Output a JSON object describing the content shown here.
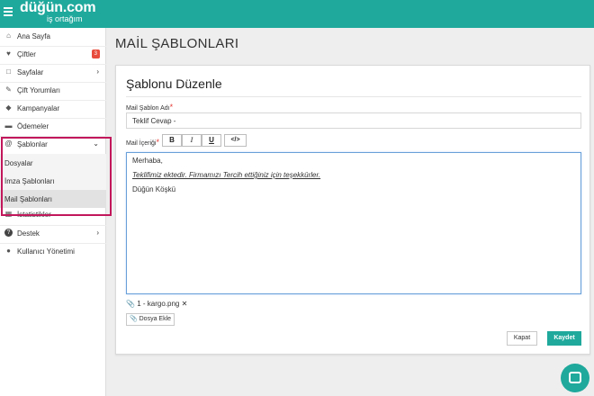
{
  "header": {
    "brand": "düğün.com",
    "brand_sub": "iş ortağım"
  },
  "sidebar": {
    "items": [
      {
        "label": "Ana Sayfa",
        "icon": "home-icon"
      },
      {
        "label": "Çiftler",
        "icon": "heart-icon",
        "badge": "3"
      },
      {
        "label": "Sayfalar",
        "icon": "monitor-icon"
      },
      {
        "label": "Çift Yorumları",
        "icon": "comments-icon"
      },
      {
        "label": "Kampanyalar",
        "icon": "tags-icon"
      },
      {
        "label": "Ödemeler",
        "icon": "credit-card-icon"
      },
      {
        "label": "Şablonlar",
        "icon": "at-icon"
      },
      {
        "label": "İstatistikler",
        "icon": "chart-icon"
      },
      {
        "label": "Destek",
        "icon": "question-icon"
      },
      {
        "label": "Kullanıcı Yönetimi",
        "icon": "users-icon"
      }
    ],
    "submenu": [
      {
        "label": "Dosyalar"
      },
      {
        "label": "İmza Şablonları"
      },
      {
        "label": "Mail Şablonları"
      }
    ]
  },
  "page": {
    "title": "MAİL ŞABLONLARI"
  },
  "card": {
    "title": "Şablonu Düzenle",
    "name_label": "Mail Şablon Adı",
    "name_value": "Teklif Cevap -",
    "content_label": "Mail İçeriği",
    "toolbar": {
      "bold": "B",
      "italic": "I",
      "underline": "U",
      "code": "</>"
    },
    "editor_lines": [
      "Merhaba,",
      "Teklifimiz ektedir. Firmamızı Tercih ettiğiniz için teşekkürler.",
      "Düğün Köşkü"
    ],
    "attachment": "1 - kargo.png",
    "add_file_label": "Dosya Ekle",
    "close_label": "Kapat",
    "save_label": "Kaydet"
  },
  "colors": {
    "accent": "#1fa89c",
    "highlight": "#c2185b",
    "badge": "#e74c3c"
  }
}
